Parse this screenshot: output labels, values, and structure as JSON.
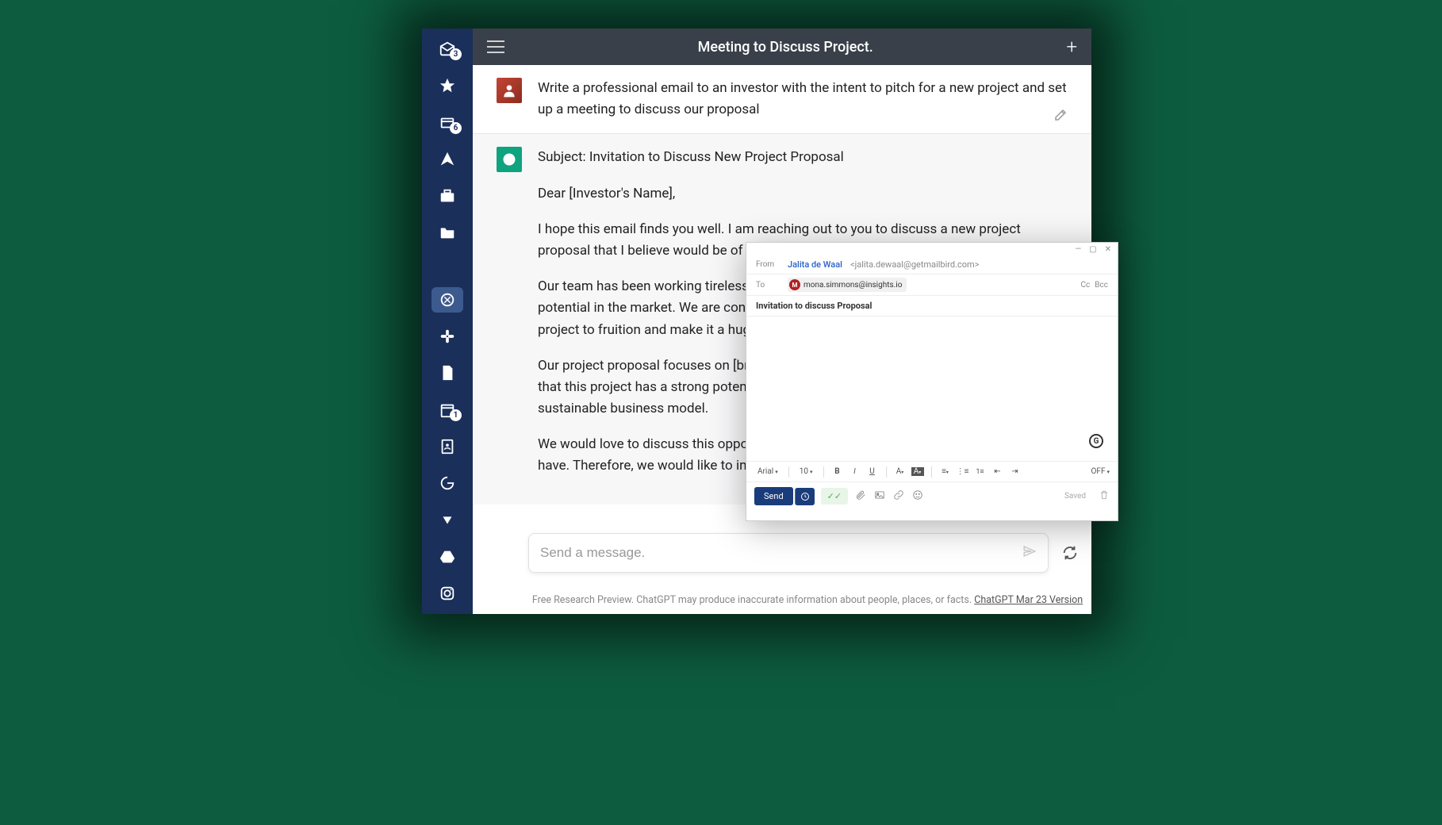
{
  "header": {
    "title": "Meeting to Discuss Project."
  },
  "sidebar": {
    "inbox_badge": "3",
    "all_badge": "6",
    "cal_badge": "1"
  },
  "chat": {
    "user_message": "Write a professional email to an investor with the intent to pitch for a new project and set up a meeting to discuss our proposal",
    "assistant_subject": "Subject: Invitation to Discuss New Project Proposal",
    "assistant_greeting": "Dear [Investor's Name],",
    "assistant_p1": "I hope this email finds you well. I am reaching out to you to discuss a new project proposal that I believe would be of great interest to you.",
    "assistant_p2": "Our team has been working tirelessly on a project that we believe has tremendous potential in the market. We are confident that with the right investment, we can bring this project to fruition and make it a huge success.",
    "assistant_p3": "Our project proposal focuses on [briefly describe the project and its benefits]. We believe that this project has a strong potential to generate significant returns and create a sustainable business model.",
    "assistant_p4": "We would love to discuss this opportunity with you and answer any questions you may have. Therefore, we would like to invite you to a meeting to discuss our project in detail."
  },
  "input": {
    "placeholder": "Send a message."
  },
  "footer": {
    "text": "Free Research Preview. ChatGPT may produce inaccurate information about people, places, or facts. ",
    "link": "ChatGPT Mar 23 Version"
  },
  "compose": {
    "from_label": "From",
    "from_name": "Jalita de Waal",
    "from_email": "<jalita.dewaal@getmailbird.com>",
    "to_label": "To",
    "to_initial": "M",
    "to_email": "mona.simmons@insights.io",
    "cc_label": "Cc",
    "bcc_label": "Bcc",
    "subject": "Invitation to discuss Proposal",
    "font": "Arial",
    "fontsize": "10",
    "off_label": "OFF",
    "send": "Send",
    "saved": "Saved"
  }
}
